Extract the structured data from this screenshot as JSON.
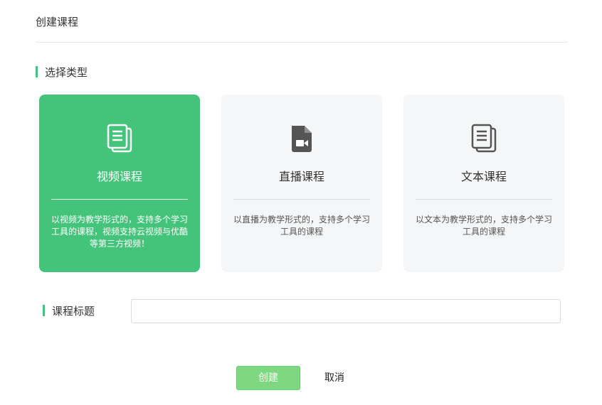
{
  "page": {
    "title": "创建课程"
  },
  "type_section": {
    "label": "选择类型"
  },
  "cards": [
    {
      "name": "视频课程",
      "desc": "以视频为教学形式的，支持多个学习工具的课程，视频支持云视频与优酷等第三方视频！",
      "icon": "document-icon",
      "selected": true
    },
    {
      "name": "直播课程",
      "desc": "以直播为教学形式的，支持多个学习工具的课程",
      "icon": "video-file-icon",
      "selected": false
    },
    {
      "name": "文本课程",
      "desc": "以文本为教学形式的，支持多个学习工具的课程",
      "icon": "document-icon",
      "selected": false
    }
  ],
  "title_field": {
    "label": "课程标题",
    "value": "",
    "placeholder": ""
  },
  "actions": {
    "create_label": "创建",
    "cancel_label": "取消"
  },
  "colors": {
    "accent": "#44c47a",
    "button": "#7ed87f",
    "card_bg": "#f5f6f7"
  }
}
